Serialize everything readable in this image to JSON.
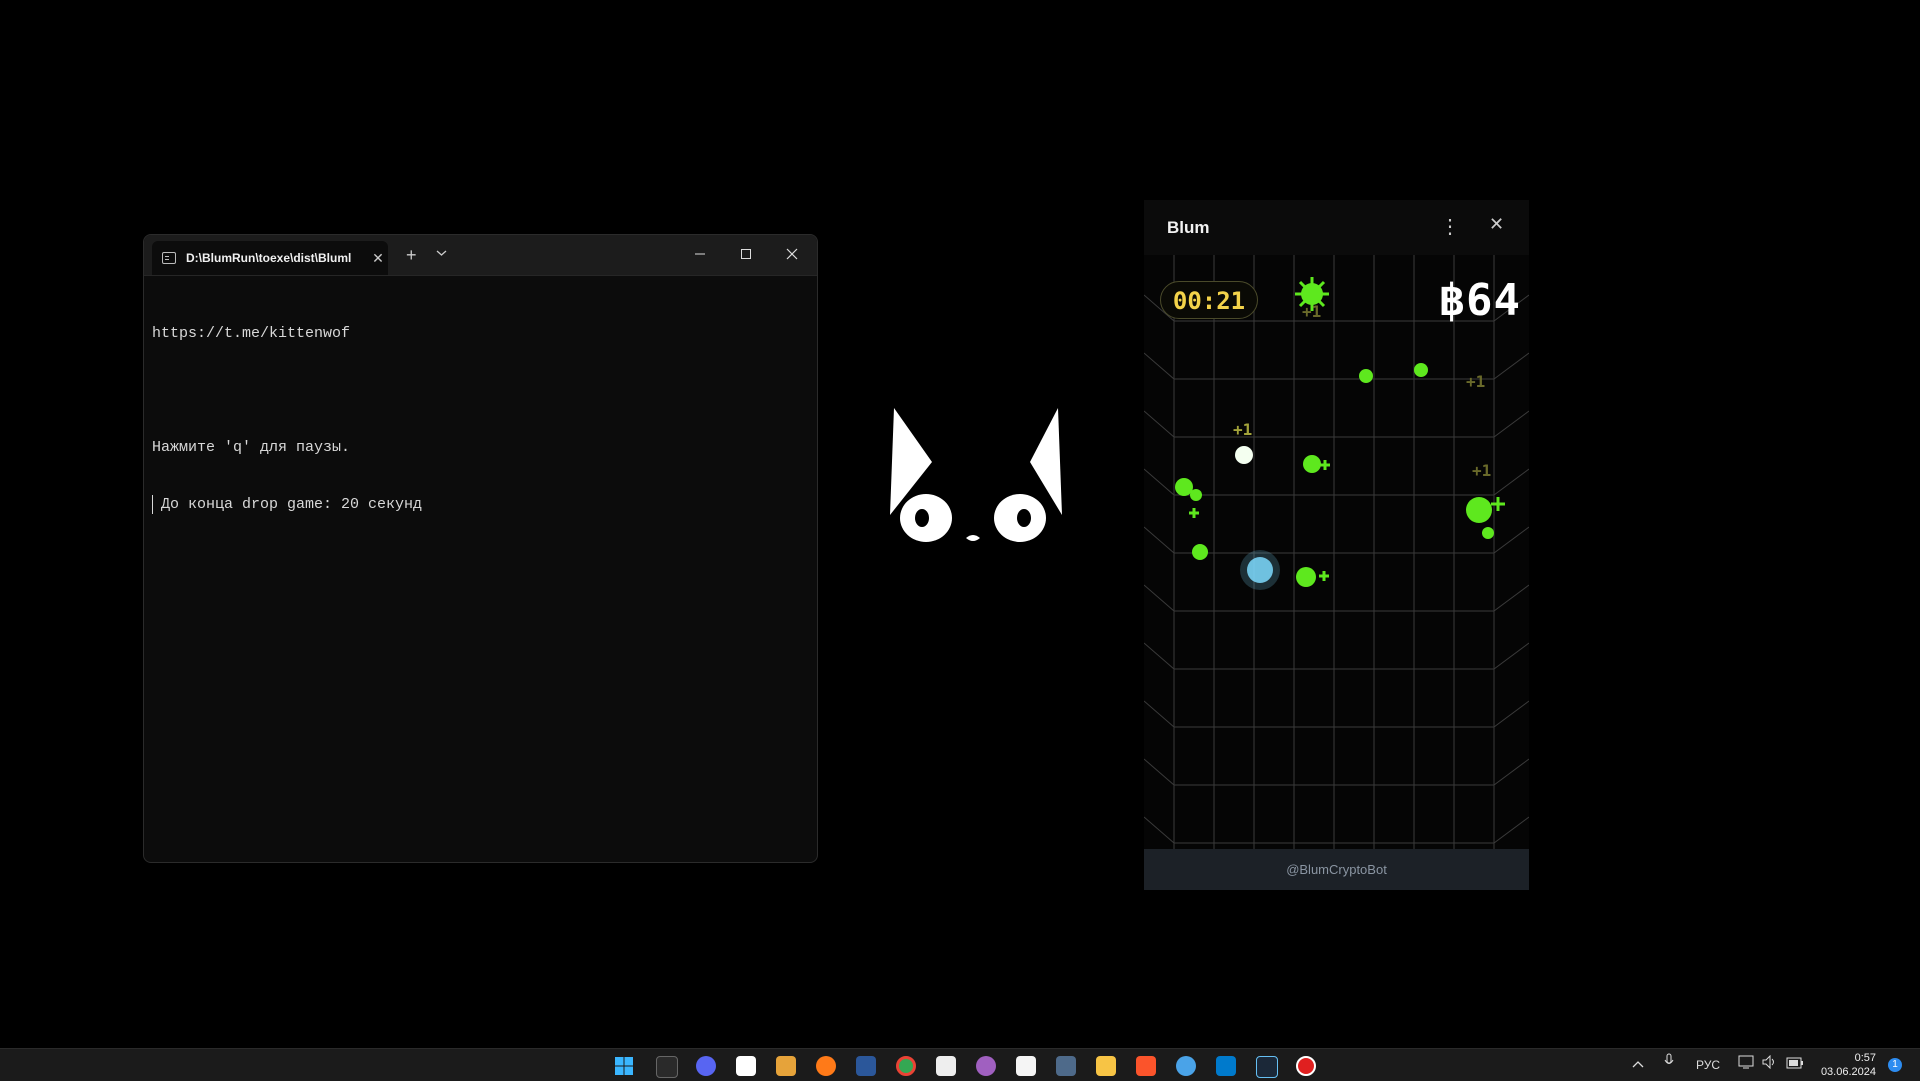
{
  "terminal": {
    "tab_title": "D:\\BlumRun\\toexe\\dist\\Bluml",
    "tab_close": "✕",
    "new_tab": "+",
    "dropdown": "⌄",
    "minimize": "—",
    "maximize": "☐",
    "close": "✕",
    "lines": [
      "https://t.me/kittenwof",
      "",
      "Нажмите 'q' для паузы.",
      "До конца drop game: 20 секунд"
    ]
  },
  "blum": {
    "title": "Blum",
    "menu_icon": "⋮",
    "close_icon": "✕",
    "timer": "00:21",
    "score_symbol": "฿",
    "score": "64",
    "footer": "@BlumCryptoBot",
    "plus_labels": [
      "+1",
      "+1",
      "+1",
      "+1"
    ],
    "colors": {
      "accent_green": "#5ee81e",
      "timer_yellow": "#f3d34a",
      "ice_blue": "#7fdcff"
    }
  },
  "taskbar": {
    "language": "РУС",
    "time": "0:57",
    "date": "03.06.2024",
    "notifications": "1",
    "icons": [
      "windows-start-icon",
      "terminal-icon",
      "discord-icon",
      "capcut-icon",
      "store-icon",
      "firefox-icon",
      "word-icon",
      "chrome-icon",
      "notion-icon",
      "app-icon",
      "clipboard-icon",
      "calculator-icon",
      "explorer-icon",
      "brave-icon",
      "vpn-icon",
      "vscode-icon",
      "steam-icon",
      "record-icon"
    ]
  }
}
